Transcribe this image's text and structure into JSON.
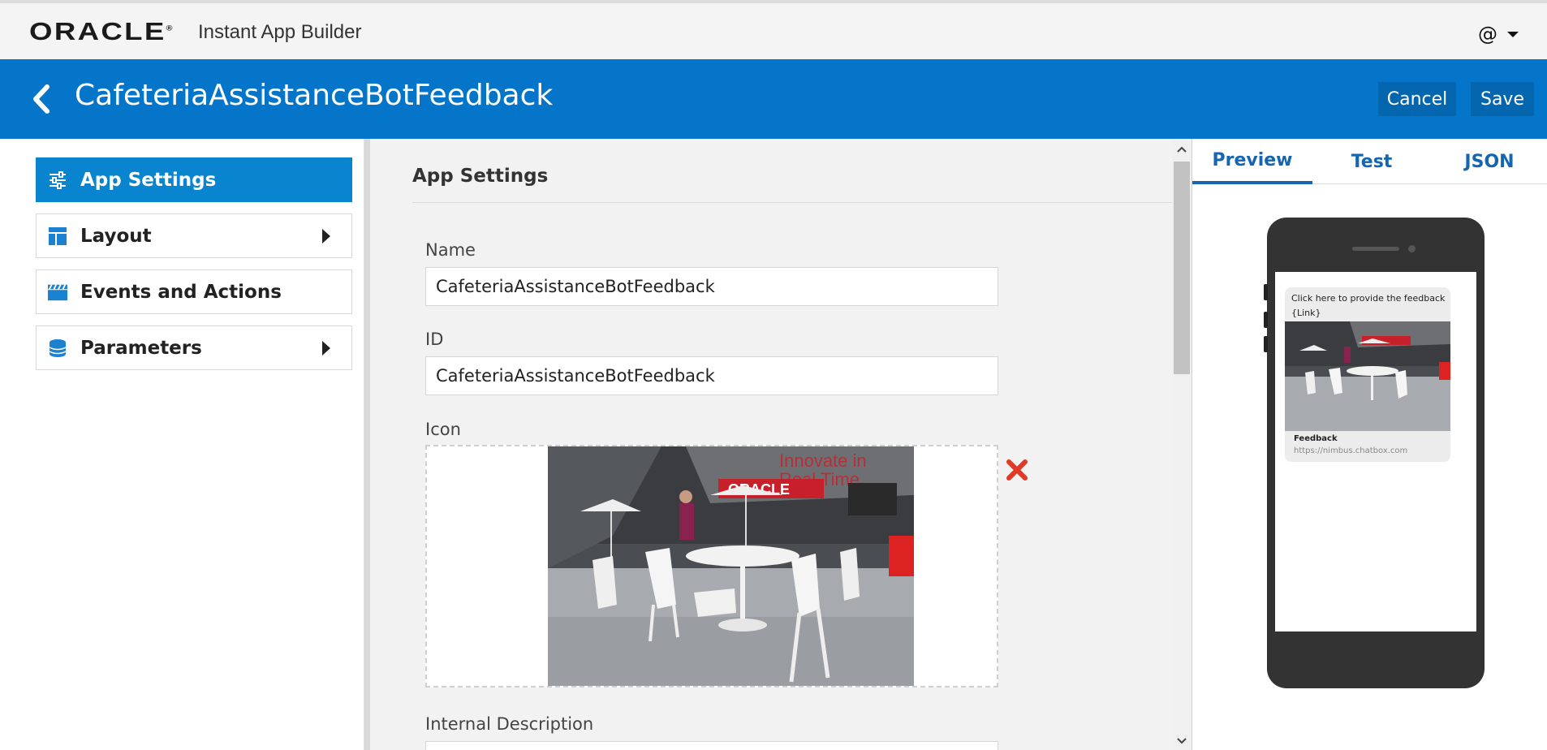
{
  "topbar": {
    "brand": "ORACLE",
    "product": "Instant App Builder",
    "user_symbol": "@"
  },
  "header": {
    "title": "CafeteriaAssistanceBotFeedback",
    "cancel_label": "Cancel",
    "save_label": "Save"
  },
  "sidebar": {
    "items": [
      {
        "label": "App Settings",
        "icon": "sliders-icon",
        "active": true,
        "expandable": false
      },
      {
        "label": "Layout",
        "icon": "layout-icon",
        "active": false,
        "expandable": true
      },
      {
        "label": "Events and Actions",
        "icon": "clapperboard-icon",
        "active": false,
        "expandable": false
      },
      {
        "label": "Parameters",
        "icon": "database-icon",
        "active": false,
        "expandable": true
      }
    ]
  },
  "main": {
    "section_title": "App Settings",
    "name_label": "Name",
    "name_value": "CafeteriaAssistanceBotFeedback",
    "id_label": "ID",
    "id_value": "CafeteriaAssistanceBotFeedback",
    "icon_label": "Icon",
    "internal_description_label": "Internal Description"
  },
  "preview": {
    "tabs": [
      "Preview",
      "Test",
      "JSON"
    ],
    "active_tab": "Preview",
    "message_text": "Click here to provide the feedback {Link}",
    "card_title": "Feedback",
    "card_url": "https://nimbus.chatbox.com"
  },
  "colors": {
    "header_blue": "#0475c9",
    "active_nav": "#0985d0",
    "tab_blue": "#1565b0",
    "remove_red": "#e03a26"
  }
}
